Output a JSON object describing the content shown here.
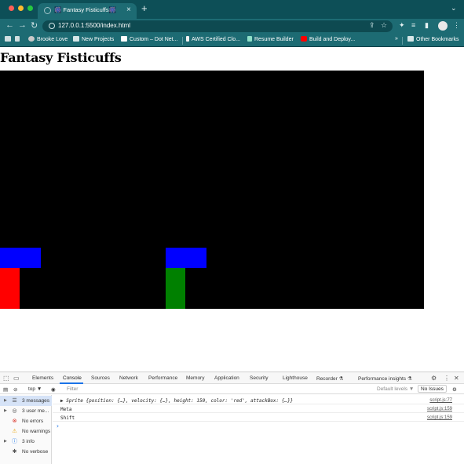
{
  "browser": {
    "tab_title": "🎆 Fantasy Fisticuffs🎆",
    "url": "127.0.0.1:5500/index.html",
    "bookmarks": [
      {
        "label": "Brooke Love"
      },
      {
        "label": "New Projects"
      },
      {
        "label": "Custom – Dot Net..."
      },
      {
        "label": "AWS Certified Clo..."
      },
      {
        "label": "Resume Builder"
      },
      {
        "label": "Build and Deploy..."
      }
    ],
    "more_label": "»",
    "other_bookmarks": "Other Bookmarks"
  },
  "page": {
    "title": "Fantasy Fisticuffs"
  },
  "game": {
    "background": "#000000",
    "player": {
      "color": "#ff0000",
      "attack_color": "#0000ff"
    },
    "enemy": {
      "color": "#008000",
      "attack_color": "#0000ff"
    }
  },
  "devtools": {
    "tabs": [
      "Elements",
      "Console",
      "Sources",
      "Network",
      "Performance",
      "Memory",
      "Application",
      "Security",
      "Lighthouse",
      "Recorder ⚗",
      "Performance insights ⚗"
    ],
    "context": "top ▼",
    "filter_placeholder": "Filter",
    "levels": "Default levels ▼",
    "issues": "No Issues",
    "sidebar": [
      {
        "label": "3 messages",
        "icon": "list-icon"
      },
      {
        "label": "3 user me...",
        "icon": "user-icon"
      },
      {
        "label": "No errors",
        "icon": "error-icon"
      },
      {
        "label": "No warnings",
        "icon": "warning-icon"
      },
      {
        "label": "3 info",
        "icon": "info-icon"
      },
      {
        "label": "No verbose",
        "icon": "bug-icon"
      }
    ],
    "logs": [
      {
        "text": "▶ Sprite {position: {…}, velocity: {…}, height: 150, color: 'red', attackBox: {…}}",
        "source": "script.js:77"
      },
      {
        "text": "Meta",
        "source": "script.js:159"
      },
      {
        "text": "Shift",
        "source": "script.js:159"
      }
    ]
  }
}
